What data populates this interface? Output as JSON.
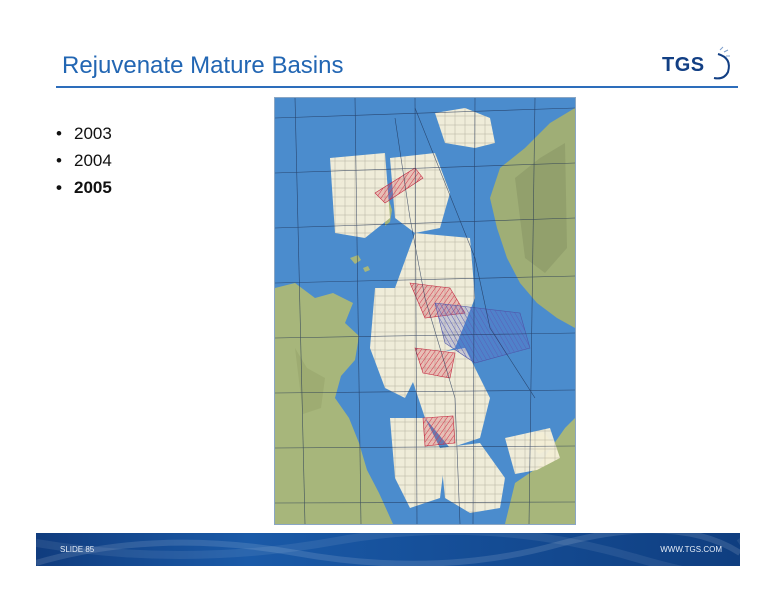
{
  "slide": {
    "title": "Rejuvenate Mature Basins",
    "logo_text": "TGS",
    "bullets": [
      {
        "text": "2003",
        "bold": false
      },
      {
        "text": "2004",
        "bold": false
      },
      {
        "text": "2005",
        "bold": true
      }
    ],
    "footer": {
      "slide_label": "SLIDE 85",
      "website": "WWW.TGS.COM"
    }
  },
  "colors": {
    "title": "#2266b3",
    "rule": "#2d6dbb",
    "sea": "#4b8ccd",
    "land": "#a7b67b",
    "blocks": "#f5efd9",
    "survey_red": "#d4384c",
    "footer": "#16509a"
  },
  "icons": [
    "tgs-logo-swoosh-icon"
  ]
}
